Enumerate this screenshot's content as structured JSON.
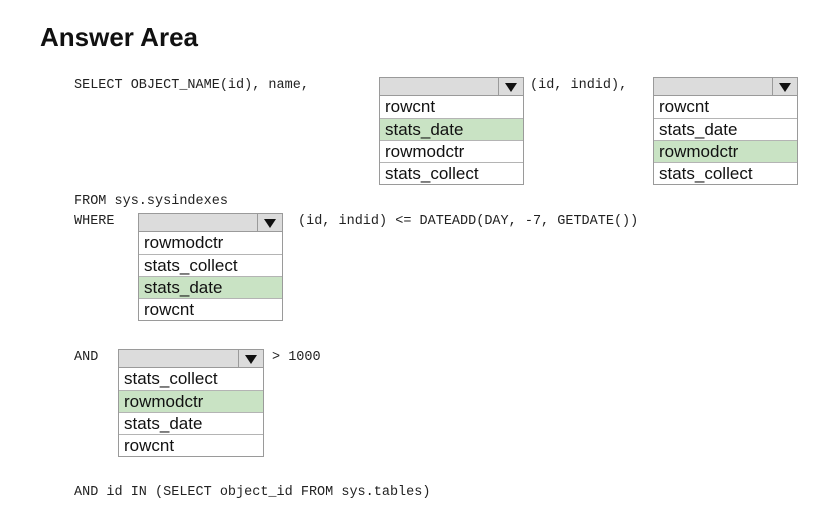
{
  "title": "Answer Area",
  "code": {
    "line1a": "SELECT OBJECT_NAME(id), name,",
    "line1b": "(id, indid),",
    "line2": "FROM sys.sysindexes",
    "line3a": "WHERE",
    "line3b": "(id, indid) <= DATEADD(DAY, -7, GETDATE())",
    "line4a": "AND",
    "line4b": "> 1000",
    "line5": "AND id IN (SELECT object_id FROM sys.tables)"
  },
  "dropdowns": [
    {
      "options": [
        "rowcnt",
        "stats_date",
        "rowmodctr",
        "stats_collect"
      ],
      "selected": "stats_date"
    },
    {
      "options": [
        "rowcnt",
        "stats_date",
        "rowmodctr",
        "stats_collect"
      ],
      "selected": "rowmodctr"
    },
    {
      "options": [
        "rowmodctr",
        "stats_collect",
        "stats_date",
        "rowcnt"
      ],
      "selected": "stats_date"
    },
    {
      "options": [
        "stats_collect",
        "rowmodctr",
        "stats_date",
        "rowcnt"
      ],
      "selected": "rowmodctr"
    }
  ],
  "colors": {
    "selected_highlight": "#c9e3c4",
    "dropdown_header": "#dcdcdc"
  }
}
